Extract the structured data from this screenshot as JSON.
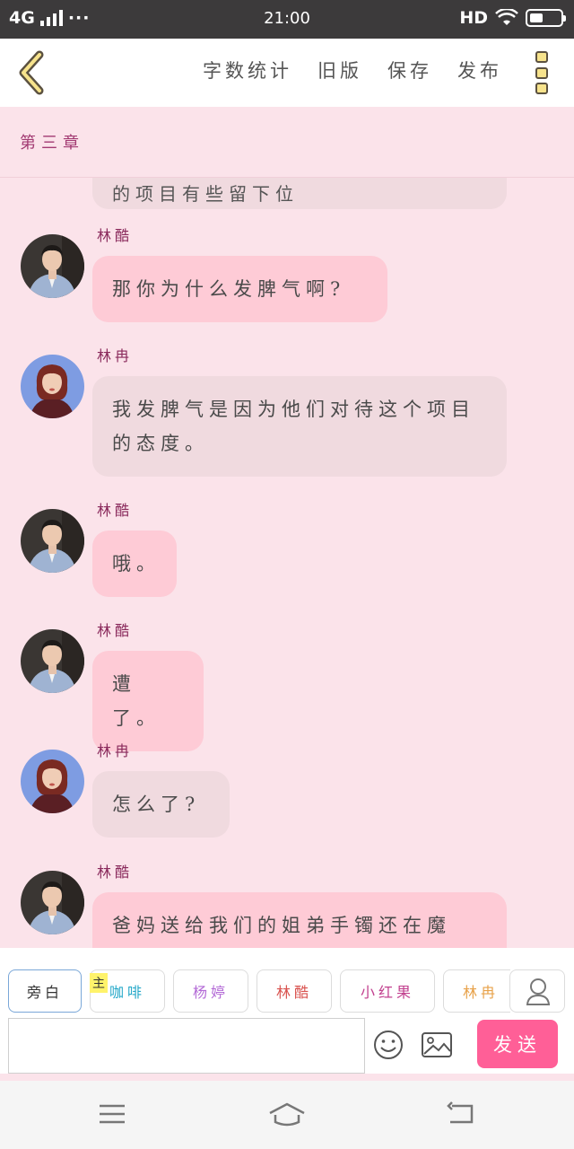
{
  "status_bar": {
    "network": "4G",
    "more": "···",
    "time": "21:00",
    "hd": "HD"
  },
  "toolbar": {
    "actions": [
      "字数统计",
      "旧版",
      "保存",
      "发布"
    ],
    "accent": "#f7e38c"
  },
  "chapter": {
    "title": "第三章"
  },
  "chat": {
    "partial_top_text": "的项目有些留下位",
    "messages": [
      {
        "author": "林酷",
        "avatar": "man",
        "text": "那你为什么发脾气啊?",
        "style": "pink"
      },
      {
        "author": "林冉",
        "avatar": "woman",
        "text": "我发脾气是因为他们对待这个项目的态度。",
        "style": "grey"
      },
      {
        "author": "林酷",
        "avatar": "man",
        "text": "哦。",
        "style": "pink"
      },
      {
        "author": "林酷",
        "avatar": "man",
        "text": "遭了。",
        "style": "pink"
      },
      {
        "author": "林冉",
        "avatar": "woman",
        "text": "怎么了?",
        "style": "grey"
      },
      {
        "author": "林酷",
        "avatar": "man",
        "text": "爸妈送给我们的姐弟手镯还在魔",
        "style": "pink"
      }
    ]
  },
  "input_panel": {
    "roles": [
      {
        "label": "旁白",
        "color": "#333333"
      },
      {
        "label": "咖啡",
        "color": "#27a9c9"
      },
      {
        "label": "杨婷",
        "color": "#b36ad6"
      },
      {
        "label": "林酷",
        "color": "#d9534f"
      },
      {
        "label": "小红果",
        "color": "#c2418f"
      },
      {
        "label": "林冉",
        "color": "#e8a24a"
      }
    ],
    "main_badge": "主",
    "send_label": "发送",
    "send_color": "#ff5f97"
  }
}
